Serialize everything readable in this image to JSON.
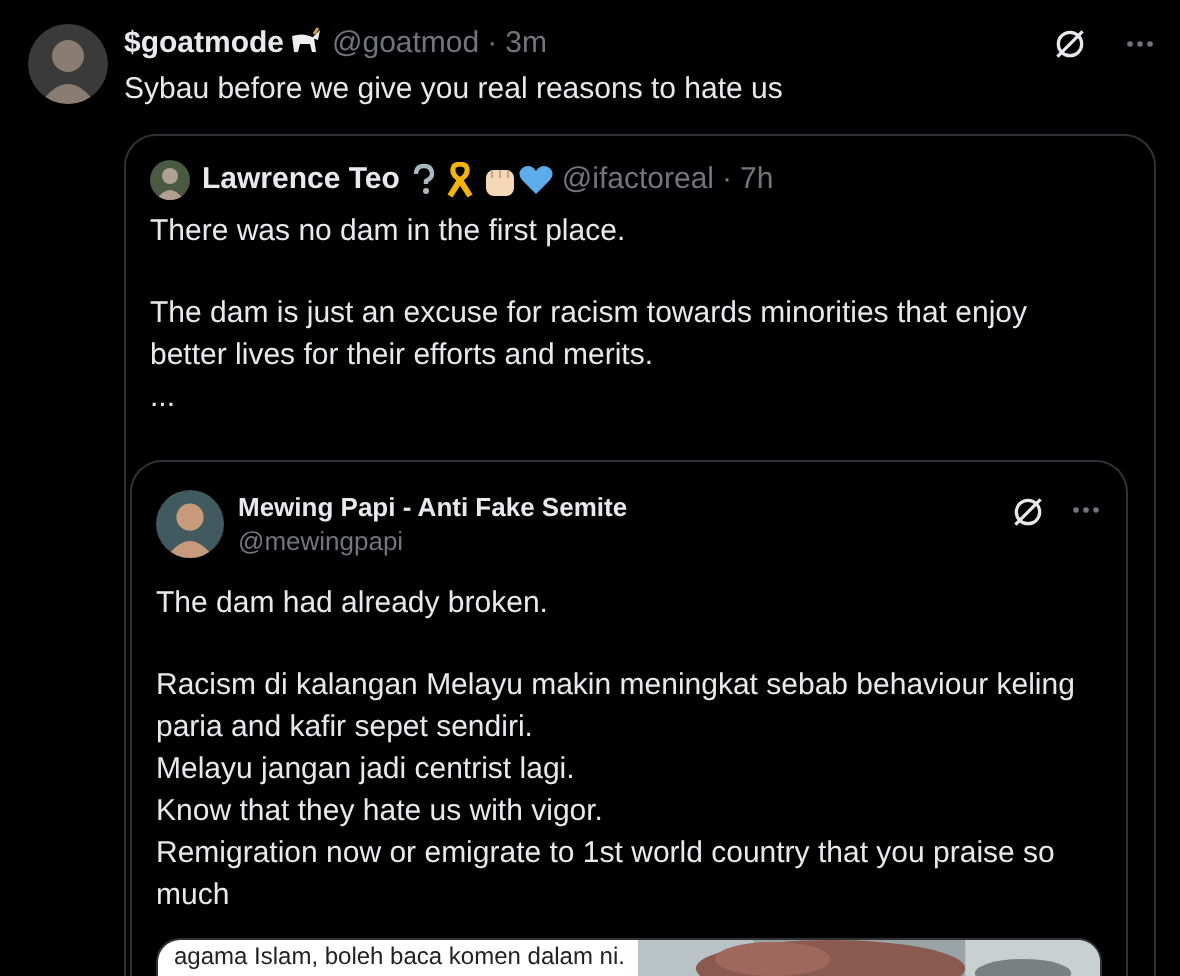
{
  "post": {
    "name": "$goatmode",
    "handle": "@goatmod",
    "separator": "·",
    "time": "3m",
    "text": "Sybau before we give you real reasons to hate us"
  },
  "quote": {
    "name": "Lawrence Teo",
    "handle": "@ifactoreal",
    "separator": "·",
    "time": "7h",
    "paragraphs": [
      "There was no dam in the first place.",
      "The dam is just an excuse for racism towards minorities that enjoy better lives for their efforts and merits.",
      "..."
    ],
    "embedded": {
      "name": "Mewing Papi - Anti Fake Semite",
      "handle": "@mewingpapi",
      "paragraphs": [
        "The dam had already broken.",
        "Racism di kalangan Melayu makin meningkat sebab behaviour keling paria and kafir sepet sendiri.\nMelayu jangan jadi centrist lagi.\nKnow that they hate us with vigor.\nRemigration now or emigrate to 1st world country that you praise so much"
      ],
      "media": [
        {
          "kind": "screenshot",
          "text": "agama Islam, boleh baca komen dalam ni."
        },
        {
          "kind": "picture"
        }
      ]
    }
  }
}
